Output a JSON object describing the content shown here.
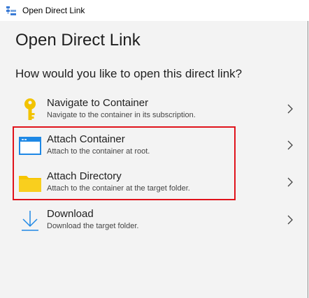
{
  "window": {
    "title": "Open Direct Link",
    "icon": "storage-explorer-icon"
  },
  "heading": "Open Direct Link",
  "question": "How would you like to open this direct link?",
  "options": [
    {
      "label": "Navigate to Container",
      "description": "Navigate to the container in its subscription.",
      "icon": "key-icon"
    },
    {
      "label": "Attach Container",
      "description": "Attach to the container at root.",
      "icon": "container-window-icon"
    },
    {
      "label": "Attach Directory",
      "description": "Attach to the container at the target folder.",
      "icon": "folder-icon"
    },
    {
      "label": "Download",
      "description": "Download the target folder.",
      "icon": "download-icon"
    }
  ],
  "colors": {
    "highlight_border": "#e0131b",
    "accent_blue": "#1e88e5",
    "key_yellow": "#f2c300",
    "folder_yellow": "#f7c500"
  }
}
